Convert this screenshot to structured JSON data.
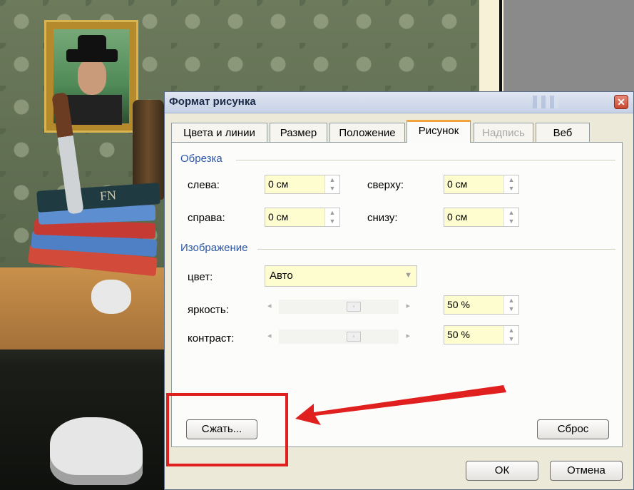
{
  "dialog": {
    "title": "Формат рисунка",
    "close_glyph": "✕",
    "tabs": [
      {
        "label": "Цвета и линии",
        "state": "normal"
      },
      {
        "label": "Размер",
        "state": "normal"
      },
      {
        "label": "Положение",
        "state": "normal"
      },
      {
        "label": "Рисунок",
        "state": "active"
      },
      {
        "label": "Надпись",
        "state": "disabled"
      },
      {
        "label": "Веб",
        "state": "normal"
      }
    ],
    "crop": {
      "section": "Обрезка",
      "left": {
        "label": "слева:",
        "value": "0 см"
      },
      "top": {
        "label": "сверху:",
        "value": "0 см"
      },
      "right": {
        "label": "справа:",
        "value": "0 см"
      },
      "bottom": {
        "label": "снизу:",
        "value": "0 см"
      }
    },
    "image": {
      "section": "Изображение",
      "color": {
        "label": "цвет:",
        "value": "Авто"
      },
      "brightness": {
        "label": "яркость:",
        "value": "50 %",
        "level": 0.5
      },
      "contrast": {
        "label": "контраст:",
        "value": "50 %",
        "level": 0.5
      }
    },
    "compress_button": "Сжать...",
    "reset_button": "Сброс",
    "ok_button": "ОК",
    "cancel_button": "Отмена"
  },
  "background": {
    "book_spine_text": "FN"
  },
  "annotation": {
    "highlight_color": "#e01f1f",
    "arrow_color": "#e01f1f"
  }
}
